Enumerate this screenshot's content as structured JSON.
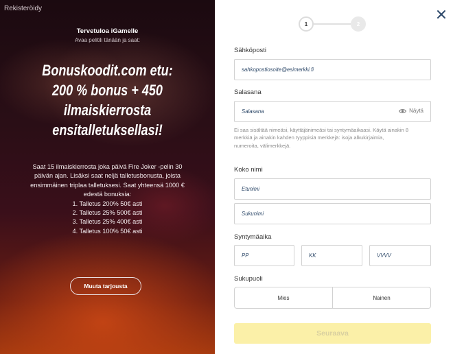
{
  "left": {
    "brand": "Rekisteröidy",
    "welcome": "Tervetuloa iGamelle",
    "subwelcome": "Avaa pelitili tänään ja saat:",
    "headline_lines": [
      "Bonuskoodit.com etu:",
      "200 % bonus + 450",
      "ilmaiskierrosta",
      "ensitalletuksellasi!"
    ],
    "description_lines": [
      "Saat 15 ilmaiskierrosta joka päivä Fire Joker -pelin 30",
      "päivän ajan. Lisäksi saat neljä talletusbonusta, joista",
      "ensimmäinen triplaa talletuksesi. Saat yhteensä 1000 €",
      "edestä bonuksia:",
      "1. Talletus 200% 50€ asti",
      "2. Talletus 25% 500€ asti",
      "3. Talletus 25% 400€ asti",
      "4. Talletus 100% 50€ asti"
    ],
    "change_offer_label": "Muuta tarjousta"
  },
  "stepper": {
    "step1": "1",
    "step2": "2"
  },
  "form": {
    "email_label": "Sähköposti",
    "email_placeholder": "sahkopostiosoite@esimerkki.fi",
    "password_label": "Salasana",
    "password_placeholder": "Salasana",
    "show_label": "Näytä",
    "password_hint_lines": [
      "Ei saa sisältää nimeäsi, käyttäjänimeäsi tai syntymäaikaasi. Käytä ainakin 8",
      "merkkiä ja ainakin kahden tyyppisiä merkkejä: isoja alkukirjaimia,",
      "numeroita, välimerkkejä."
    ],
    "fullname_label": "Koko nimi",
    "firstname_placeholder": "Etunimi",
    "lastname_placeholder": "Sukunimi",
    "dob_label": "Syntymäaika",
    "day_placeholder": "PP",
    "month_placeholder": "KK",
    "year_placeholder": "VVVV",
    "gender_label": "Sukupuoli",
    "gender_male": "Mies",
    "gender_female": "Nainen",
    "next_label": "Seuraava"
  },
  "colors": {
    "accent": "#fbf0a8",
    "close": "#2e4a6b",
    "placeholder": "#2f4a6a"
  },
  "icons": {
    "close": "close-icon",
    "eye": "eye-icon"
  }
}
